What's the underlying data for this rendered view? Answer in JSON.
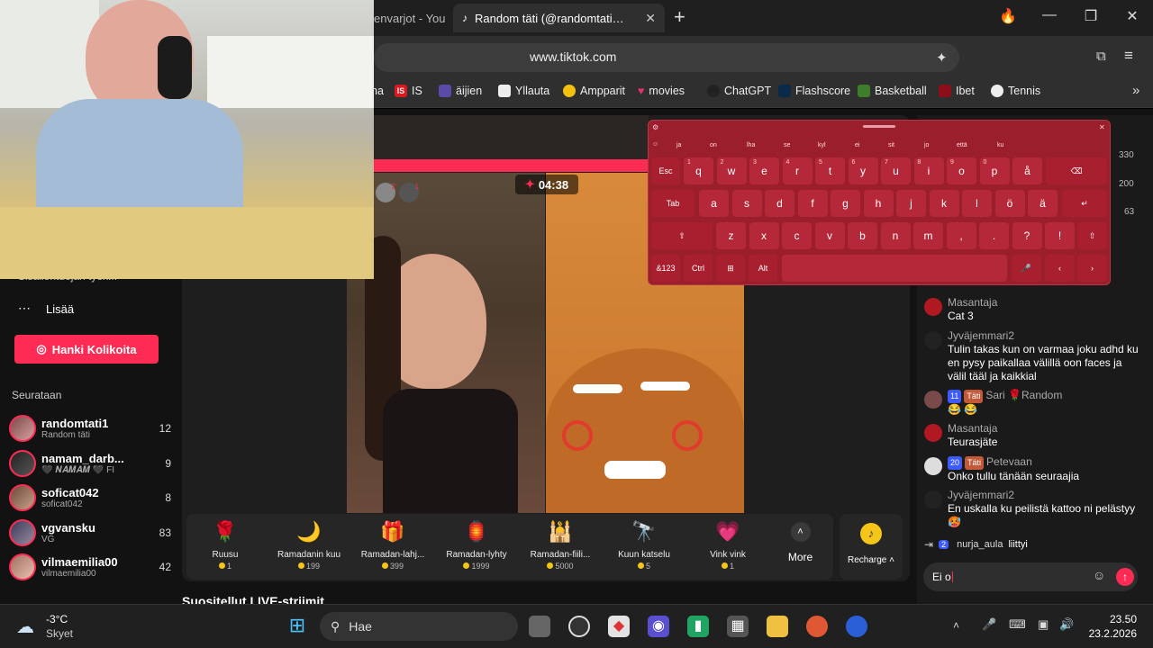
{
  "browser": {
    "tabs": [
      {
        "title": "envarjot - You",
        "active": false
      },
      {
        "title": "Random täti (@randomtati1) o",
        "active": true
      }
    ],
    "url": "www.tiktok.com",
    "bookmarks": [
      "na",
      "IS",
      "äijien",
      "Yllauta",
      "Ampparit",
      "movies",
      "ChatGPT",
      "Flashscore",
      "Basketball",
      "Ibet",
      "Tennis"
    ]
  },
  "sidebar": {
    "partial_item": "Sisällöntuojan työk...",
    "more_label": "Lisää",
    "coins_button": "Hanki Kolikoita",
    "following_heading": "Seurataan",
    "following": [
      {
        "name": "randomtati1",
        "sub": "Random täti",
        "count": "12"
      },
      {
        "name": "namam_darb...",
        "sub": "🖤 𝑵𝑨𝑴𝑨𝑴 🖤 FI",
        "count": "9"
      },
      {
        "name": "soficat042",
        "sub": "soficat042",
        "count": "8"
      },
      {
        "name": "vgvansku",
        "sub": "VG",
        "count": "83"
      },
      {
        "name": "vilmaemilia00",
        "sub": "vilmaemilia00",
        "count": "42"
      }
    ]
  },
  "live": {
    "timer": "04:38",
    "viewer_badges": [
      "2",
      "1"
    ],
    "gifts": [
      {
        "name": "Ruusu",
        "price": "1",
        "icon": "🌹"
      },
      {
        "name": "Ramadanin kuu",
        "price": "199",
        "icon": "🌙"
      },
      {
        "name": "Ramadan-lahj...",
        "price": "399",
        "icon": "🎁"
      },
      {
        "name": "Ramadan-lyhty",
        "price": "1999",
        "icon": "🏮"
      },
      {
        "name": "Ramadan-fiili...",
        "price": "5000",
        "icon": "🕌"
      },
      {
        "name": "Kuun katselu",
        "price": "5",
        "icon": "🔭"
      },
      {
        "name": "Vink vink",
        "price": "1",
        "icon": "💗"
      }
    ],
    "more_label": "More",
    "recharge_label": "Recharge",
    "recommended_heading": "Suositellut LIVE-striimit"
  },
  "ranking_stats": [
    "330",
    "200",
    "63"
  ],
  "chat": {
    "messages": [
      {
        "user": "Masantaja",
        "text": "Cat 3",
        "badges": []
      },
      {
        "user": "Jyväjemmari2",
        "text": "Tulin takas kun on varmaa joku adhd ku en pysy paikallaa välillä oon faces ja välil tääl ja kaikkial",
        "badges": []
      },
      {
        "user": "Sari 🌹Random",
        "text": "😂 😂",
        "badges": [
          "11",
          "Täti"
        ]
      },
      {
        "user": "Masantaja",
        "text": "Teurasjäte",
        "badges": []
      },
      {
        "user": "Petevaan",
        "text": "Onko tullu tänään seuraajia",
        "badges": [
          "20",
          "Täti"
        ]
      },
      {
        "user": "Jyväjemmari2",
        "text": "En uskalla ku peilistä kattoo ni pelästyy 🥵",
        "badges": []
      }
    ],
    "join_event": {
      "badge": "2",
      "user": "nurja_aula",
      "action": "liittyi"
    },
    "input_value": "Ei o"
  },
  "keyboard": {
    "suggestions": [
      "ja",
      "on",
      "lha",
      "se",
      "kyl",
      "ei",
      "sit",
      "jo",
      "että",
      "ku"
    ],
    "row1": [
      {
        "k": "Esc",
        "s": ""
      },
      {
        "k": "q",
        "s": "1"
      },
      {
        "k": "w",
        "s": "2"
      },
      {
        "k": "e",
        "s": "3"
      },
      {
        "k": "r",
        "s": "4"
      },
      {
        "k": "t",
        "s": "5"
      },
      {
        "k": "y",
        "s": "6"
      },
      {
        "k": "u",
        "s": "7"
      },
      {
        "k": "i",
        "s": "8"
      },
      {
        "k": "o",
        "s": "9"
      },
      {
        "k": "p",
        "s": "0"
      },
      {
        "k": "å",
        "s": ""
      },
      {
        "k": "⌫",
        "s": ""
      }
    ],
    "row2": [
      "Tab",
      "a",
      "s",
      "d",
      "f",
      "g",
      "h",
      "j",
      "k",
      "l",
      "ö",
      "ä",
      "↵"
    ],
    "row3": [
      "⇧",
      "z",
      "x",
      "c",
      "v",
      "b",
      "n",
      "m",
      ",",
      ".",
      "?",
      "!",
      "⇧"
    ],
    "row4": [
      "&123",
      "Ctrl",
      "⊞",
      "Alt",
      "",
      "🎤",
      "‹",
      "›"
    ]
  },
  "taskbar": {
    "weather_temp": "-3°C",
    "weather_desc": "Skyet",
    "search_placeholder": "Hae",
    "time": "23.50",
    "date": "23.2.2026"
  }
}
